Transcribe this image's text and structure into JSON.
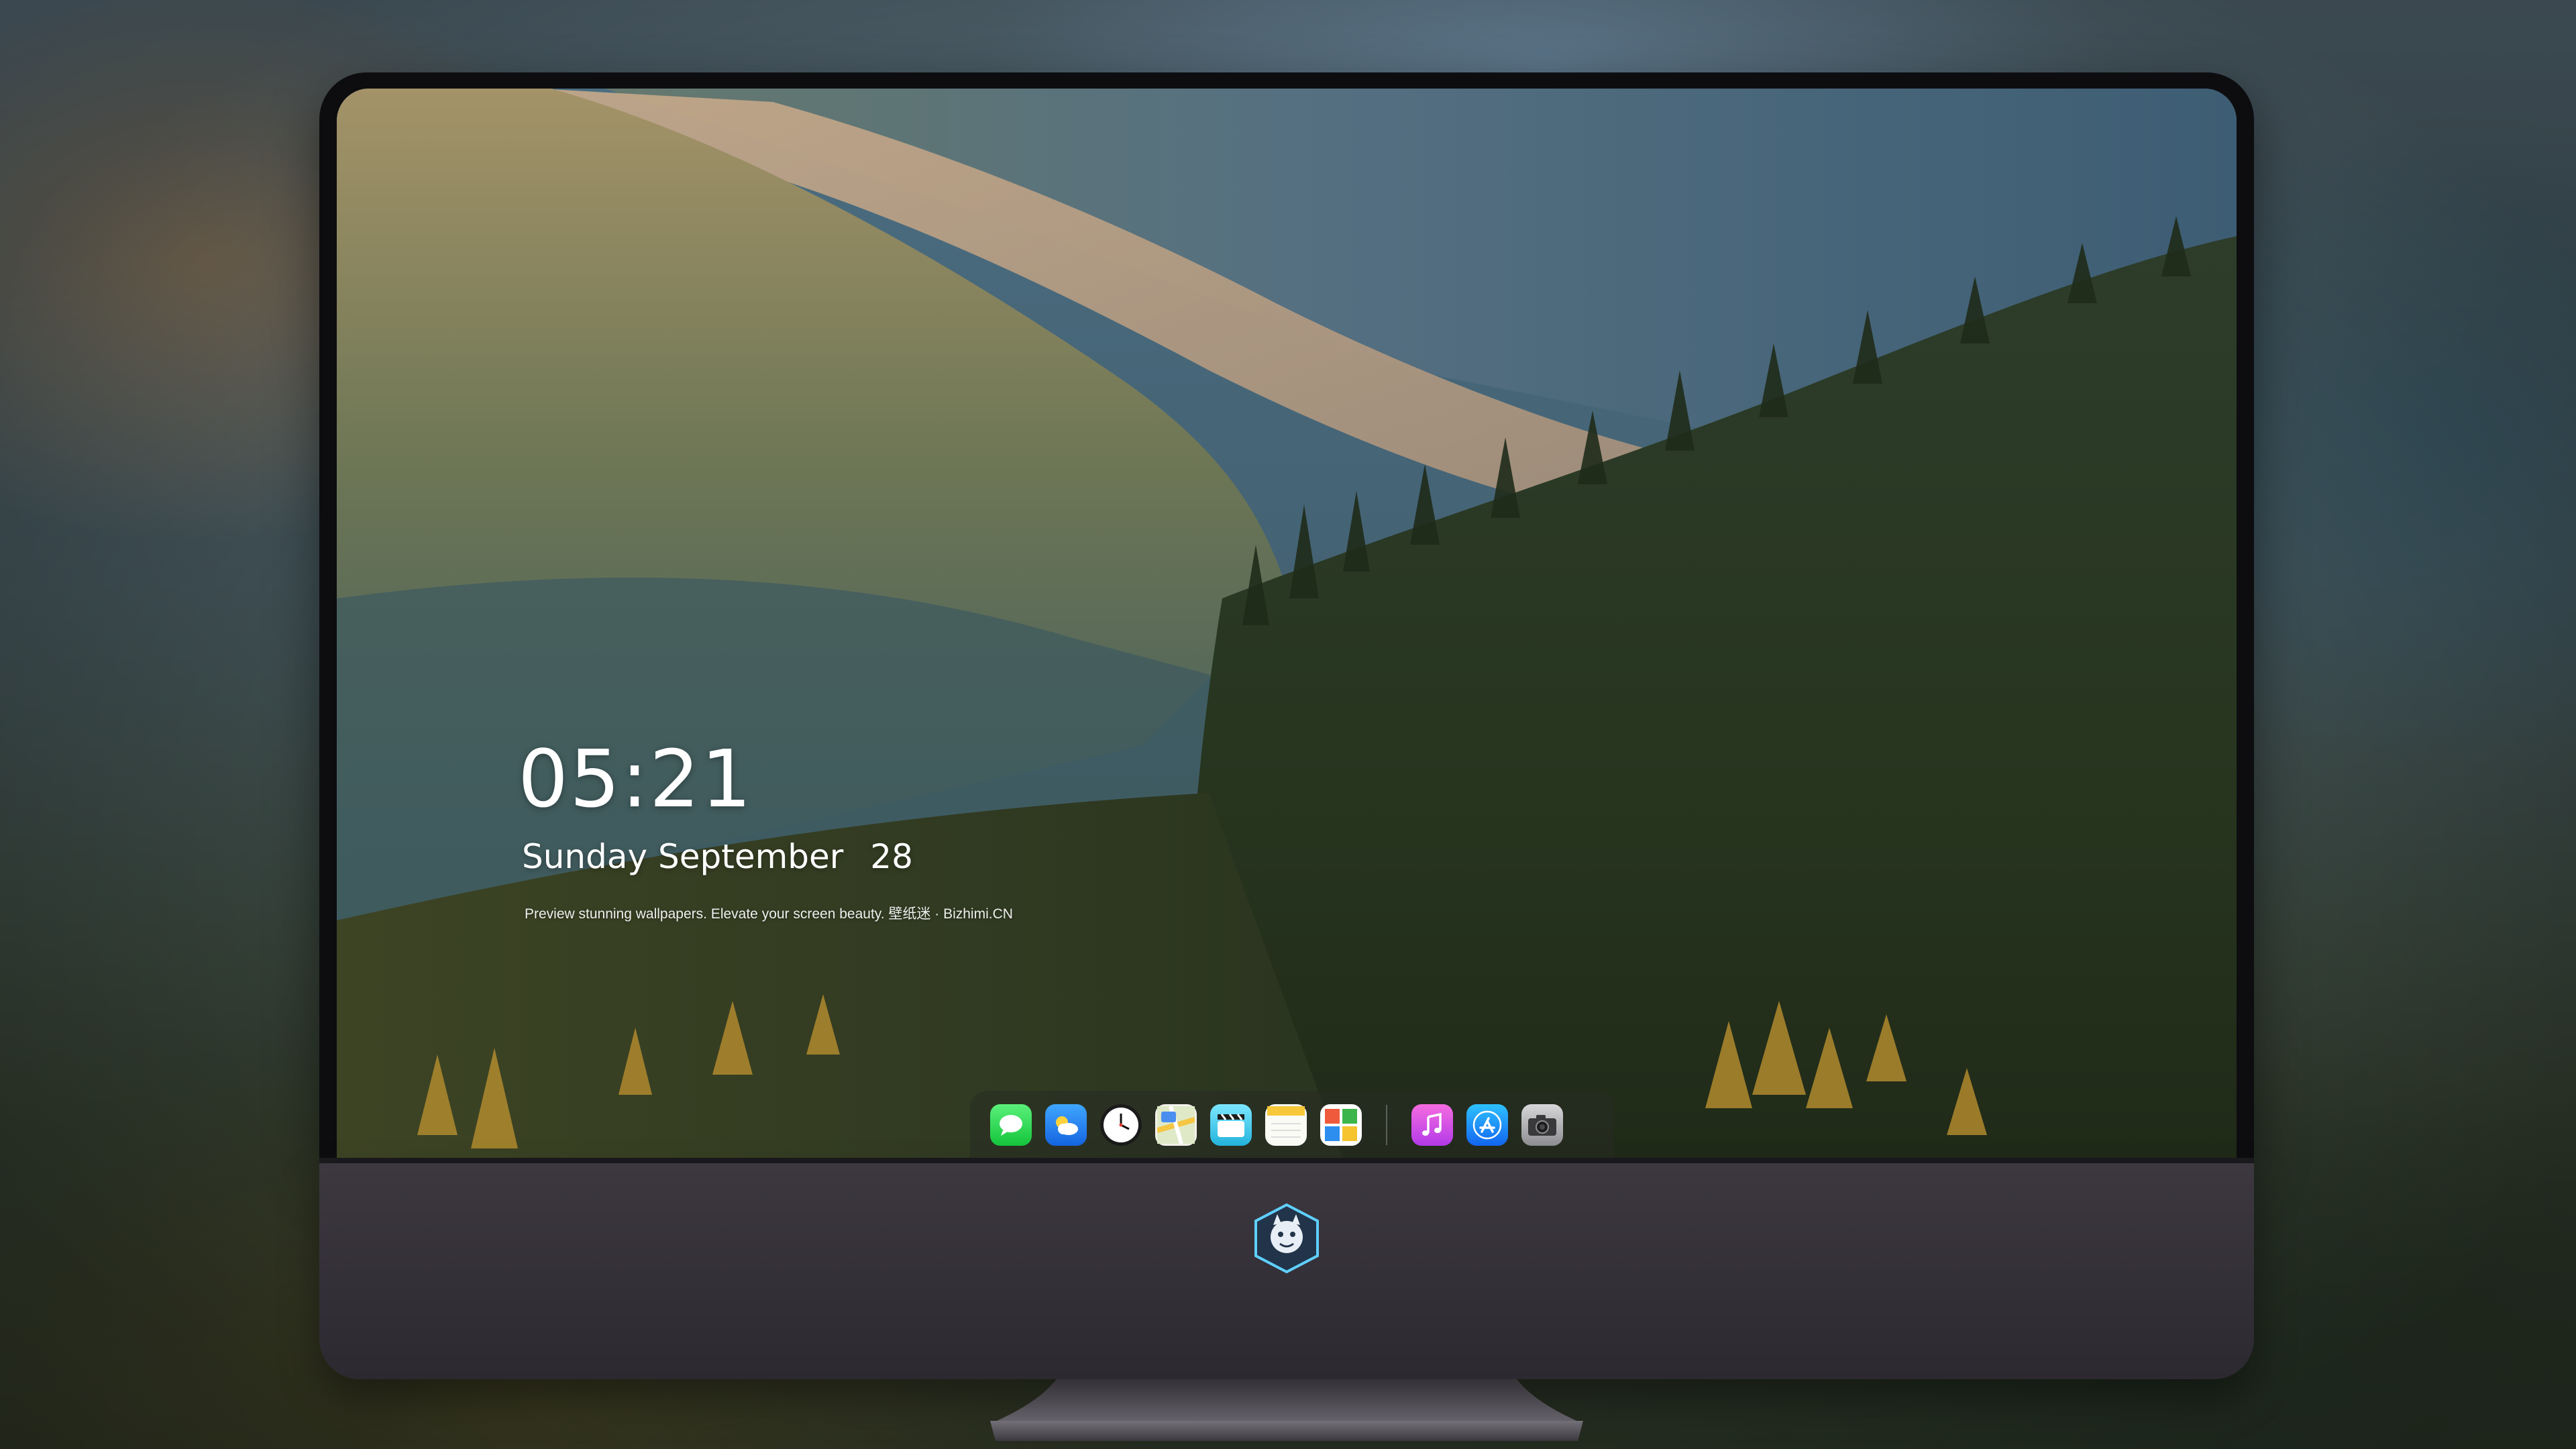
{
  "lockscreen": {
    "time": "05:21",
    "weekday": "Sunday",
    "month": "September",
    "day": "28",
    "tagline": "Preview stunning wallpapers. Elevate your screen beauty. 壁纸迷 · Bizhimi.CN"
  },
  "dock": {
    "apps": [
      {
        "name": "Messages",
        "icon": "messages-icon"
      },
      {
        "name": "Weather",
        "icon": "weather-icon"
      },
      {
        "name": "Clock",
        "icon": "clock-icon"
      },
      {
        "name": "Maps",
        "icon": "maps-icon"
      },
      {
        "name": "Clips",
        "icon": "clips-icon"
      },
      {
        "name": "Notes",
        "icon": "notes-icon"
      },
      {
        "name": "Photos",
        "icon": "photos-icon"
      },
      {
        "name": "iTunes",
        "icon": "music-icon"
      },
      {
        "name": "App Store",
        "icon": "app-store-icon"
      },
      {
        "name": "Camera",
        "icon": "camera-icon"
      }
    ]
  },
  "colors": {
    "bezel": "#0d0d10",
    "chin": "#3d3840",
    "text": "#ffffff"
  }
}
